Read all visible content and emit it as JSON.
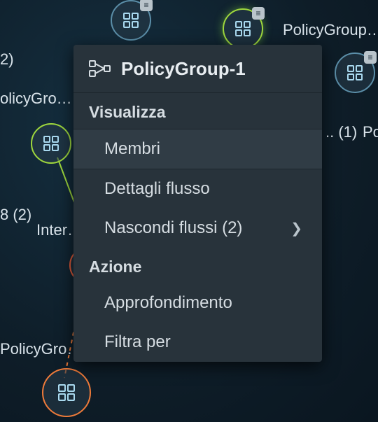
{
  "menu": {
    "title": "PolicyGroup-1",
    "section_view": "Visualizza",
    "section_action": "Azione",
    "items": {
      "members": "Membri",
      "flow_details": "Dettagli flusso",
      "hide_flows": "Nascondi flussi (2)",
      "deep_dive": "Approfondimento",
      "filter_by": "Filtra per"
    }
  },
  "graph": {
    "labels": {
      "top_right": "PolicyGroup…",
      "left_count_2": "2)",
      "left_policy": "olicyGro…",
      "right_count_1": ".. (1)",
      "right_policy": "Po…",
      "mid_left": "8 (2)",
      "mid_intel": "Inter…",
      "bottom_policy": "PolicyGro…"
    }
  }
}
